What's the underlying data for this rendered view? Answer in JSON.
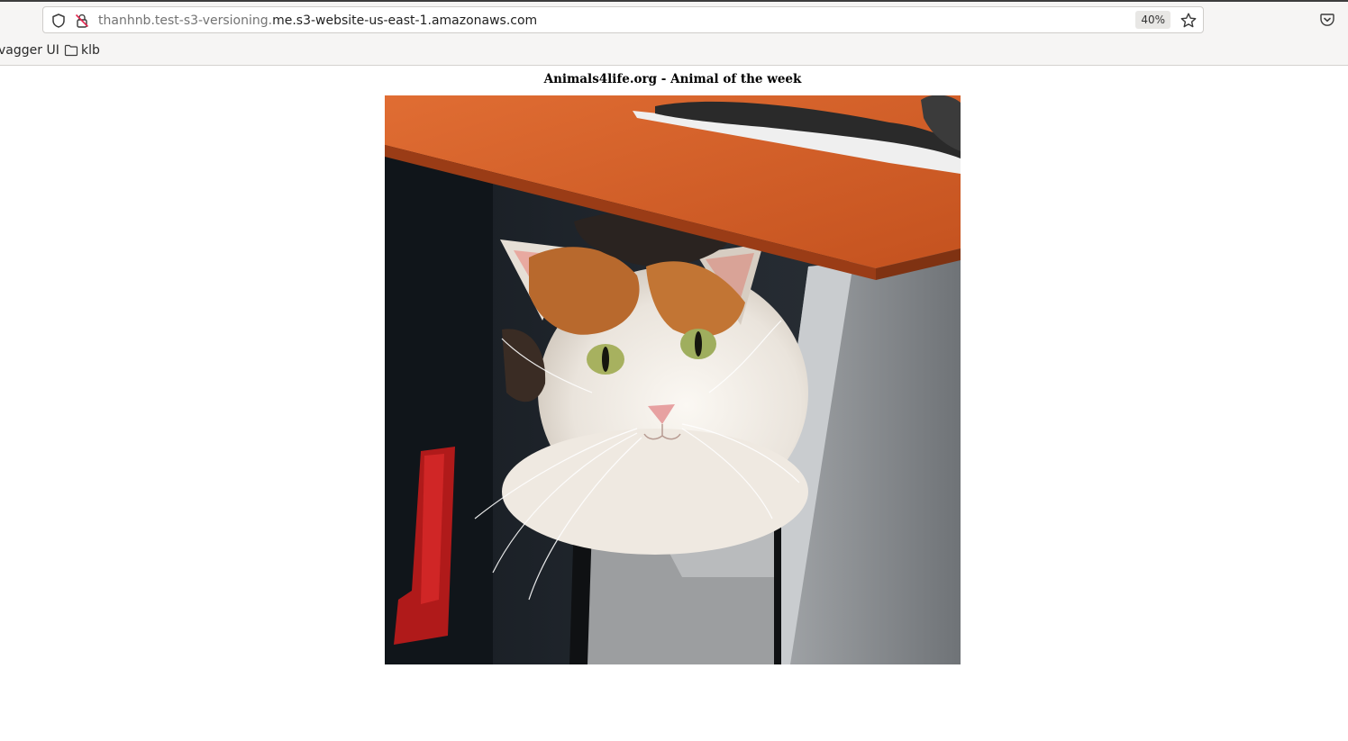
{
  "browser": {
    "url_subdomain": "thanhnb.test-s3-versioning.",
    "url_domain": "me.s3-website-us-east-1.amazonaws.com",
    "zoom": "40%",
    "icons": {
      "shield": "shield-icon",
      "insecure": "insecure-lock-icon",
      "bookmark": "star-icon",
      "pocket": "pocket-icon",
      "folder": "folder-icon"
    },
    "bookmarks": [
      {
        "label": "vagger UI"
      },
      {
        "label": "klb"
      }
    ]
  },
  "page": {
    "title": "Animals4life.org - Animal of the week"
  },
  "colors": {
    "desk": "#d6602a",
    "cat_white": "#f3efe9",
    "cat_orange": "#b8692d",
    "cabinet_grey": "#8f9296"
  }
}
